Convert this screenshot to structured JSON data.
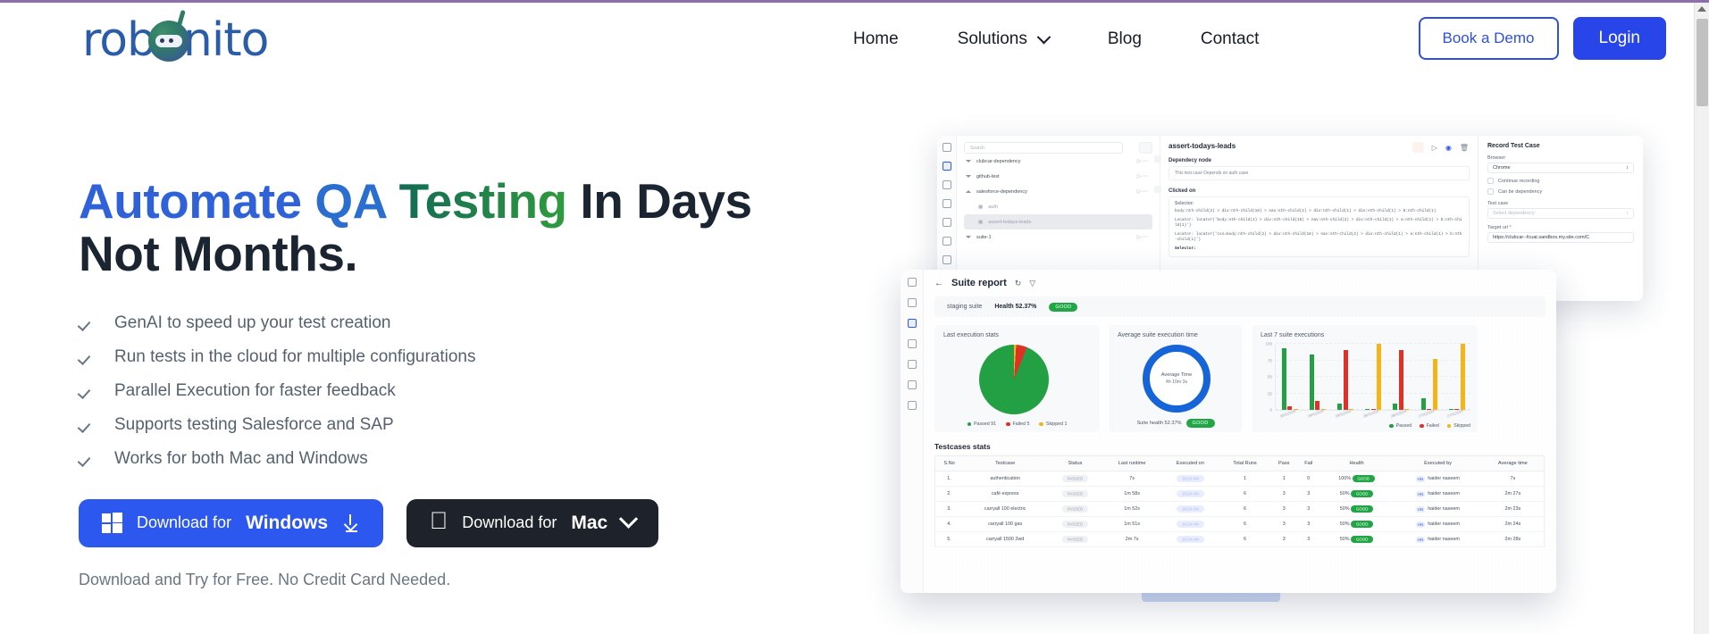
{
  "brand": {
    "name": "robonito",
    "accent_blue": "#2745e8",
    "accent_green": "#2f9b3d"
  },
  "header": {
    "nav": [
      {
        "label": "Home",
        "has_caret": false
      },
      {
        "label": "Solutions",
        "has_caret": true
      },
      {
        "label": "Blog",
        "has_caret": false
      },
      {
        "label": "Contact",
        "has_caret": false
      }
    ],
    "demo_button": "Book a Demo",
    "login_button": "Login"
  },
  "hero": {
    "headline_part1": "Automate ",
    "headline_part2": "QA ",
    "headline_part3": "Testing",
    "headline_part4": " In Days",
    "headline_line2": "Not Months.",
    "features": [
      "GenAI to speed up your test creation",
      "Run tests in the cloud for multiple configurations",
      "Parallel Execution for faster feedback",
      "Supports testing Salesforce and SAP",
      "Works for both Mac and Windows"
    ],
    "windows_button": {
      "prefix": "Download for",
      "os": "Windows"
    },
    "mac_button": {
      "prefix": "Download for",
      "os": "Mac"
    },
    "footnote": "Download and Try for Free. No Credit Card Needed."
  },
  "editor_shot": {
    "search_placeholder": "Search",
    "tree": [
      {
        "label": "clubcar-dependency",
        "type": "folder"
      },
      {
        "label": "github-test",
        "type": "folder"
      },
      {
        "label": "salesforce-dependency",
        "type": "folder"
      },
      {
        "label": "auth",
        "type": "file"
      },
      {
        "label": "assert-todays-leads",
        "type": "file"
      },
      {
        "label": "suite-1",
        "type": "folder"
      }
    ],
    "title": "assert-todays-leads",
    "sections": [
      {
        "heading": "Dependecy node",
        "body": "This test case Depends on auth case"
      },
      {
        "heading": "Clicked on",
        "body": "Selector:"
      }
    ],
    "code_lines": [
      "body:nth-child(2) > div:nth-child(18) > nav:nth-child(2) > div:nth-child(1) > div:nth-child(1) > b:nth-child(1)",
      "Locator: locator('body:nth-child(2) > div:nth-child(18) > nav:nth-child(2) > div:nth-child(1) > a:nth-child(1) > b:nth-child(1)')",
      "Locator: locator('css=body:nth-child(2) > div:nth-child(18) > nav:nth-child(2) > div:nth-child(1) > a:nth-child(1) > b:nth-child(1)')"
    ],
    "record_panel": {
      "title": "Record Test Case",
      "browser_label": "Browser",
      "browser_value": "Chrome",
      "checkbox_continue": "Continue recording",
      "checkbox_dependency": "Can be dependency",
      "testcase_label": "Test case",
      "testcase_placeholder": "Select dependency",
      "target_label": "Target url",
      "target_value": "https://clubcar--fcuat.sandbox.my.site.com/C"
    }
  },
  "report_shot": {
    "title": "Suite report",
    "suite_name": "staging suite",
    "health_label": "Health 52.37%",
    "health_badge": "GOOD",
    "card_titles": {
      "last_execution": "Last execution stats",
      "avg_time": "Average suite execution time",
      "last_7": "Last 7 suite executions"
    },
    "avg_time": {
      "label": "Average Time",
      "value": "4h 10m 3s"
    },
    "suite_health": {
      "label": "Suite health 52.37%",
      "badge": "GOOD"
    },
    "table_title": "Testcases stats",
    "table_headers": [
      "S.No",
      "Testcase",
      "Status",
      "Last runtime",
      "Executed on",
      "Total Runs",
      "Pass",
      "Fail",
      "Health",
      "Executed by",
      "Average time"
    ],
    "table_rows": [
      {
        "sno": "1.",
        "testcase": "authentication",
        "status": "PASSED",
        "last_runtime": "7s",
        "executed_on": "10:24 AM",
        "total_runs": "1",
        "pass": "1",
        "fail": "0",
        "health_pct": "100%",
        "health_badge": "GOOD",
        "avatar": "HN",
        "executed_by": "haider naseem",
        "avg_time": "7s"
      },
      {
        "sno": "2.",
        "testcase": "café express",
        "status": "PASSED",
        "last_runtime": "1m 58s",
        "executed_on": "10:24 AM",
        "total_runs": "6",
        "pass": "3",
        "fail": "3",
        "health_pct": "50%",
        "health_badge": "GOOD",
        "avatar": "HN",
        "executed_by": "haider naseem",
        "avg_time": "2m 27s"
      },
      {
        "sno": "3.",
        "testcase": "carryall 100 electric",
        "status": "PASSED",
        "last_runtime": "1m 52s",
        "executed_on": "10:24 AM",
        "total_runs": "6",
        "pass": "3",
        "fail": "3",
        "health_pct": "50%",
        "health_badge": "GOOD",
        "avatar": "HN",
        "executed_by": "haider naseem",
        "avg_time": "2m 23s"
      },
      {
        "sno": "4.",
        "testcase": "carryall 100 gas",
        "status": "PASSED",
        "last_runtime": "1m 51s",
        "executed_on": "10:24 AM",
        "total_runs": "6",
        "pass": "3",
        "fail": "3",
        "health_pct": "50%",
        "health_badge": "GOOD",
        "avatar": "HN",
        "executed_by": "haider naseem",
        "avg_time": "2m 24s"
      },
      {
        "sno": "5.",
        "testcase": "carryall 1500 2wd",
        "status": "PASSED",
        "last_runtime": "2m 7s",
        "executed_on": "10:24 AM",
        "total_runs": "6",
        "pass": "3",
        "fail": "3",
        "health_pct": "50%",
        "health_badge": "GOOD",
        "avatar": "HN",
        "executed_by": "haider naseem",
        "avg_time": "2m 28s"
      }
    ]
  },
  "chart_data": [
    {
      "type": "pie",
      "title": "Last execution stats",
      "labels": [
        "Passed",
        "Failed",
        "Skipped"
      ],
      "values": [
        91,
        5,
        1
      ],
      "legend": [
        "Passed 91",
        "Failed 5",
        "Skipped 1"
      ],
      "colors": [
        "#22a043",
        "#e03127",
        "#f5b418"
      ],
      "legend_position": "bottom"
    },
    {
      "type": "pie",
      "title": "Average suite execution time",
      "subtitle": "Average Time",
      "center_value": "4h 10m 3s",
      "labels": [
        "Suite health"
      ],
      "values": [
        52.37
      ],
      "colors": [
        "#1565d8"
      ],
      "annotation": "Suite health 52.37%",
      "legend_position": "bottom"
    },
    {
      "type": "bar",
      "title": "Last 7 suite executions",
      "categories": [
        "30/6/2024",
        "29/6/2024",
        "29/6/2024",
        "28/6/2024",
        "28/6/2024",
        "27/6/2024",
        "27/6/2024"
      ],
      "series": [
        {
          "name": "Passed",
          "color": "#22a043",
          "values": [
            93,
            84,
            9,
            1,
            9,
            18,
            1
          ]
        },
        {
          "name": "Failed",
          "color": "#e03127",
          "values": [
            5,
            13,
            90,
            0,
            90,
            2,
            0
          ]
        },
        {
          "name": "Skipped",
          "color": "#f5b418",
          "values": [
            1,
            1,
            1,
            100,
            1,
            77,
            100
          ]
        }
      ],
      "ylabel": "",
      "xlabel": "",
      "ylim": [
        0,
        100
      ],
      "yticks": [
        0,
        25,
        50,
        75,
        100
      ],
      "grid": true,
      "legend_position": "bottom-right"
    }
  ]
}
